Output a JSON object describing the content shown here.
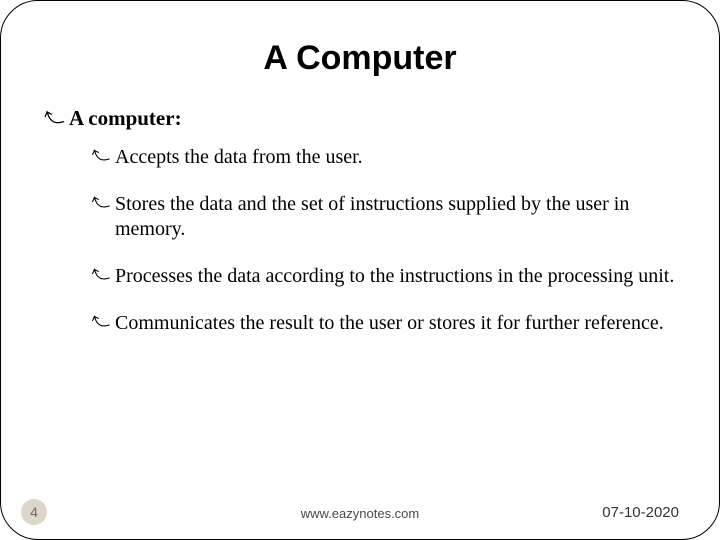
{
  "title": "A Computer",
  "level1": {
    "label": "A computer:"
  },
  "bullets": [
    "Accepts the data from the user.",
    "Stores the data and the set of instructions supplied by the user in memory.",
    "Processes the data according to the instructions in the processing unit.",
    "Communicates the result to the user or stores it for further reference."
  ],
  "footer": {
    "page": "4",
    "site": "www.eazynotes.com",
    "date": "07-10-2020"
  }
}
